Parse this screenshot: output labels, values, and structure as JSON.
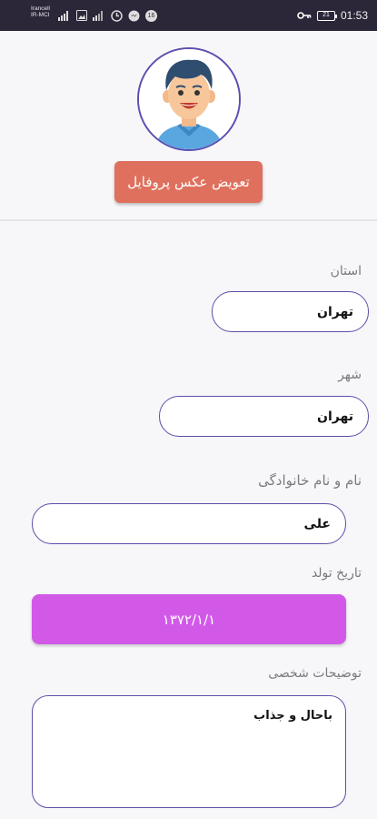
{
  "status_bar": {
    "carrier_line1": "Irancell",
    "carrier_line2": "IR-MCI",
    "signal_badge": "LTE",
    "notification_count": "16",
    "battery_level": "21",
    "time": "01:53"
  },
  "profile": {
    "avatar_icon": "user-avatar-icon",
    "change_photo_label": "تعویض عکس پروفایل"
  },
  "form": {
    "province_label": "استان",
    "province_value": "تهران",
    "city_label": "شهر",
    "city_value": "تهران",
    "fullname_label": "نام و نام خانوادگی",
    "fullname_value": "علی",
    "birthdate_label": "تاریخ تولد",
    "birthdate_value": "۱۳۷۲/۱/۱",
    "bio_label": "توضیحات شخصی",
    "bio_value": "باحال و جذاب"
  },
  "colors": {
    "status_bar_bg": "#2c2639",
    "accent_purple": "#5a50a8",
    "change_photo_bg": "#df705d",
    "date_button_bg": "#d259e8"
  }
}
